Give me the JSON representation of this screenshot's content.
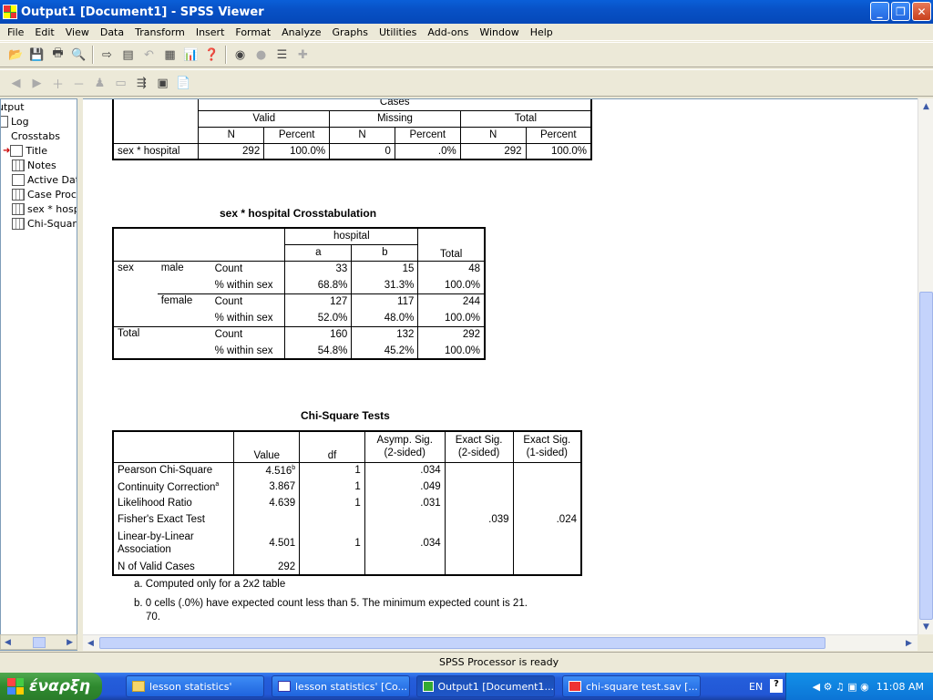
{
  "window": {
    "title": "Output1 [Document1] - SPSS Viewer"
  },
  "menu": [
    "File",
    "Edit",
    "View",
    "Data",
    "Transform",
    "Insert",
    "Format",
    "Analyze",
    "Graphs",
    "Utilities",
    "Add-ons",
    "Window",
    "Help"
  ],
  "outline": {
    "items": [
      "utput",
      "Log",
      "Crosstabs",
      "Title",
      "Notes",
      "Active Data",
      "Case Proce",
      "sex * hosp",
      "Chi-Square"
    ]
  },
  "case_table": {
    "cases": "Cases",
    "valid": "Valid",
    "missing": "Missing",
    "total": "Total",
    "n": "N",
    "percent": "Percent",
    "row_label": "sex * hospital",
    "values": [
      "292",
      "100.0%",
      "0",
      ".0%",
      "292",
      "100.0%"
    ]
  },
  "crosstab": {
    "title": "sex * hospital Crosstabulation",
    "col_group": "hospital",
    "cols": [
      "a",
      "b"
    ],
    "total": "Total",
    "sex": "sex",
    "male": "male",
    "female": "female",
    "total_row": "Total",
    "count": "Count",
    "within": "% within sex",
    "male_count": [
      "33",
      "15",
      "48"
    ],
    "male_pct": [
      "68.8%",
      "31.3%",
      "100.0%"
    ],
    "female_count": [
      "127",
      "117",
      "244"
    ],
    "female_pct": [
      "52.0%",
      "48.0%",
      "100.0%"
    ],
    "total_count": [
      "160",
      "132",
      "292"
    ],
    "total_pct": [
      "54.8%",
      "45.2%",
      "100.0%"
    ]
  },
  "chisq": {
    "title": "Chi-Square Tests",
    "headers": [
      "Value",
      "df",
      "Asymp. Sig.",
      "(2-sided)",
      "Exact Sig.",
      "(2-sided)",
      "Exact Sig.",
      "(1-sided)"
    ],
    "rows": [
      {
        "label": "Pearson Chi-Square",
        "value": "4.516",
        "sup": "b",
        "df": "1",
        "asymp": ".034",
        "exact2": "",
        "exact1": ""
      },
      {
        "label": "Continuity Correction",
        "sup_label": "a",
        "value": "3.867",
        "df": "1",
        "asymp": ".049",
        "exact2": "",
        "exact1": ""
      },
      {
        "label": "Likelihood Ratio",
        "value": "4.639",
        "df": "1",
        "asymp": ".031",
        "exact2": "",
        "exact1": ""
      },
      {
        "label": "Fisher's Exact Test",
        "value": "",
        "df": "",
        "asymp": "",
        "exact2": ".039",
        "exact1": ".024"
      },
      {
        "label": "Linear-by-Linear",
        "label2": "Association",
        "value": "4.501",
        "df": "1",
        "asymp": ".034",
        "exact2": "",
        "exact1": ""
      },
      {
        "label": "N of Valid Cases",
        "value": "292",
        "df": "",
        "asymp": "",
        "exact2": "",
        "exact1": ""
      }
    ],
    "footnote_a": "a. Computed only for a 2x2 table",
    "footnote_b1": "b. 0 cells (.0%) have expected count less than 5. The minimum expected count is 21.",
    "footnote_b2": "70."
  },
  "status": {
    "text": "SPSS Processor is ready"
  },
  "taskbar": {
    "start": "έναρξη",
    "tasks": [
      "lesson statistics'",
      "lesson statistics' [Co...",
      "Output1 [Document1...",
      "chi-square test.sav [..."
    ],
    "lang": "EN",
    "clock": "11:08 AM"
  }
}
